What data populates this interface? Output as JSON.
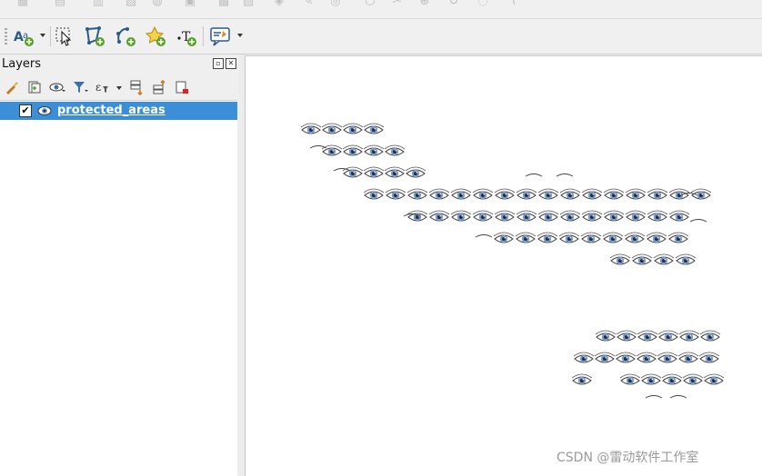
{
  "top_strip": {
    "icons": [
      "add-raster-icon",
      "add-delimited-icon",
      "add-spatialite-icon",
      "add-postgis-icon",
      "add-wms-icon",
      "add-wfs-icon",
      "add-wcs-icon",
      "add-vector-icon",
      "add-virtual-icon",
      "digitize-icon",
      "vertex-icon",
      "node-tool-icon",
      "cut-icon",
      "merge-icon",
      "rotate-icon",
      "simplify-icon",
      "reshape-icon"
    ]
  },
  "toolbar": {
    "items": [
      {
        "name": "label-tool-button",
        "icon": "label-abc-icon",
        "dropdown": true
      },
      {
        "name": "select-features-button",
        "icon": "select-cursor-icon",
        "dropdown": false
      },
      {
        "name": "add-polygon-button",
        "icon": "polygon-add-icon",
        "dropdown": false
      },
      {
        "name": "add-curve-button",
        "icon": "curve-add-icon",
        "dropdown": false
      },
      {
        "name": "add-star-button",
        "icon": "star-add-icon",
        "dropdown": false
      },
      {
        "name": "add-text-button",
        "icon": "text-add-icon",
        "dropdown": false
      },
      {
        "name": "annotation-button",
        "icon": "annotation-icon",
        "dropdown": true
      }
    ]
  },
  "layers_panel": {
    "title": "Layers",
    "tools": [
      "open-styling-icon",
      "add-group-icon",
      "manage-visibility-icon",
      "filter-legend-icon",
      "filter-expression-icon",
      "expand-all-icon",
      "collapse-all-icon",
      "remove-layer-icon"
    ],
    "layers": [
      {
        "name": "protected_areas",
        "checked": true,
        "selected": true
      }
    ]
  },
  "canvas": {
    "accent": "#3c8fd6",
    "symbol": "eye-marker-icon"
  },
  "watermark": {
    "text": "CSDN @雷动软件工作室"
  }
}
